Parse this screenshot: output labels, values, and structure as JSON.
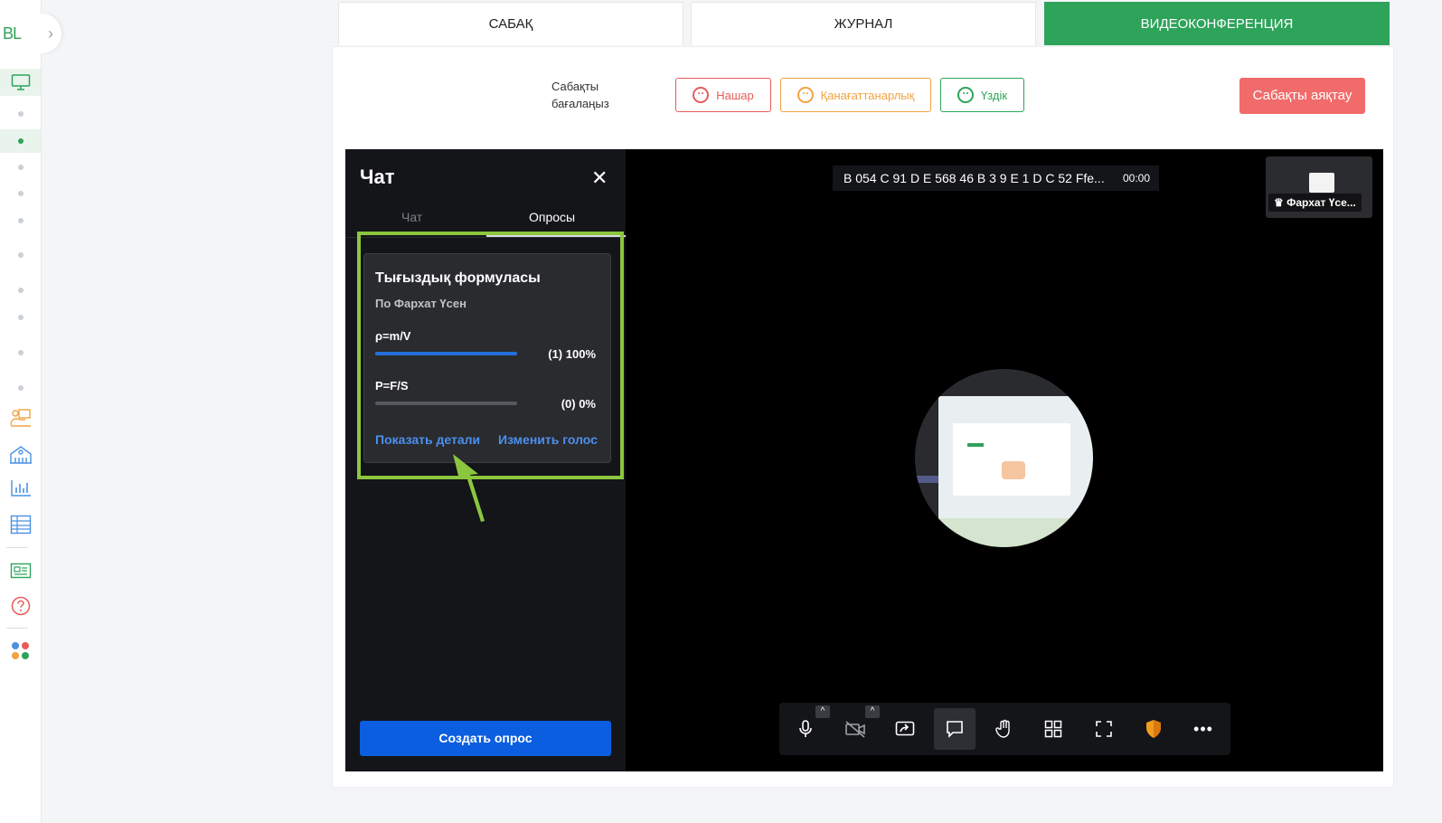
{
  "sidebar": {
    "logo": "BL",
    "expand_icon": "chevron-right-icon",
    "items": [
      {
        "icon": "monitor-icon",
        "active": true
      },
      {
        "icon": "dot"
      },
      {
        "icon": "dot",
        "active": true
      },
      {
        "icon": "dot"
      },
      {
        "icon": "dot"
      },
      {
        "icon": "dot"
      },
      {
        "icon": "dot"
      },
      {
        "icon": "dot"
      },
      {
        "icon": "dot"
      },
      {
        "icon": "dot"
      },
      {
        "icon": "dot"
      },
      {
        "icon": "teacher-icon"
      },
      {
        "icon": "school-icon"
      },
      {
        "icon": "bar-chart-icon"
      },
      {
        "icon": "table-icon"
      },
      {
        "icon": "news-icon"
      },
      {
        "icon": "help-icon"
      },
      {
        "icon": "apps-icon"
      }
    ]
  },
  "tabs": [
    {
      "label": "САБАҚ",
      "active": false
    },
    {
      "label": "ЖУРНАЛ",
      "active": false
    },
    {
      "label": "ВИДЕОКОНФЕРЕНЦИЯ",
      "active": true
    }
  ],
  "rating": {
    "label_line1": "Сабақты",
    "label_line2": "бағалаңыз",
    "bad": "Нашар",
    "ok": "Қанағаттанарлық",
    "good": "Үздік",
    "end_lesson": "Сабақты аяқтау"
  },
  "chat": {
    "title": "Чат",
    "tab_chat": "Чат",
    "tab_polls": "Опросы",
    "poll": {
      "title": "Тығыздық формуласы",
      "author": "По Фархат Үсен",
      "options": [
        {
          "label": "ρ=m/V",
          "result": "(1) 100%",
          "fraction": 1.0
        },
        {
          "label": "P=F/S",
          "result": "(0) 0%",
          "fraction": 0.0
        }
      ],
      "show_details": "Показать детали",
      "change_vote": "Изменить голос"
    },
    "create_poll": "Создать опрос"
  },
  "video": {
    "room_id": "B 054 C 91 D E 568 46 B 3 9 E 1 D C 52 Ffe...",
    "timer": "00:00",
    "participant_name": "Фархат Үсе..."
  },
  "toolbar": {
    "buttons": [
      "microphone-icon",
      "camera-off-icon",
      "screen-share-icon",
      "chat-icon",
      "raise-hand-icon",
      "tile-view-icon",
      "fullscreen-icon",
      "security-shield-icon",
      "more-icon"
    ]
  },
  "colors": {
    "brand_green": "#2ea35a",
    "end_red": "#f16b6b",
    "poll_blue": "#246fdb",
    "highlight_lime": "#8cc63f"
  }
}
